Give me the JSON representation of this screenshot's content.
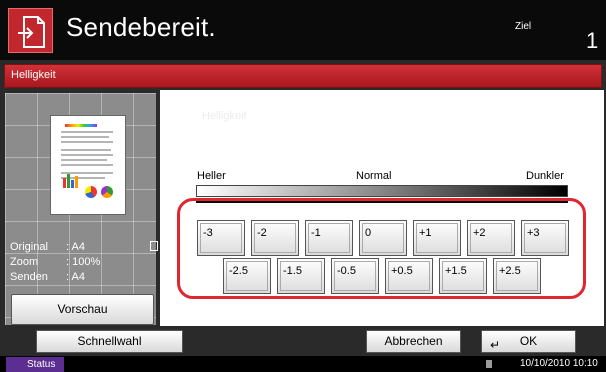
{
  "header": {
    "title": "Sendebereit.",
    "destination_label": "Ziel",
    "destination_count": "1",
    "icon": "send-document-icon"
  },
  "titlebar": {
    "text": "Helligkeit"
  },
  "left": {
    "info": [
      {
        "key": "Original",
        "value": ": A4"
      },
      {
        "key": "Zoom",
        "value": ": 100%"
      },
      {
        "key": "Senden",
        "value": ": A4"
      }
    ],
    "preview_button": "Vorschau"
  },
  "right": {
    "ghost_title": "Helligkeit",
    "scale": {
      "lighter": "Heller",
      "normal": "Normal",
      "darker": "Dunkler"
    },
    "row1": [
      "-3",
      "-2",
      "-1",
      "0",
      "+1",
      "+2",
      "+3"
    ],
    "row2": [
      "-2.5",
      "-1.5",
      "-0.5",
      "+0.5",
      "+1.5",
      "+2.5"
    ]
  },
  "footer": {
    "quick_button": "Schnellwahl",
    "cancel_button": "Abbrechen",
    "ok_button": "OK"
  },
  "statusbar": {
    "status_label": "Status",
    "datetime": "10/10/2010 10:10"
  },
  "colors": {
    "accent_red": "#c1272d",
    "status_purple": "#5c2e91",
    "highlight_red": "#e0272f"
  }
}
